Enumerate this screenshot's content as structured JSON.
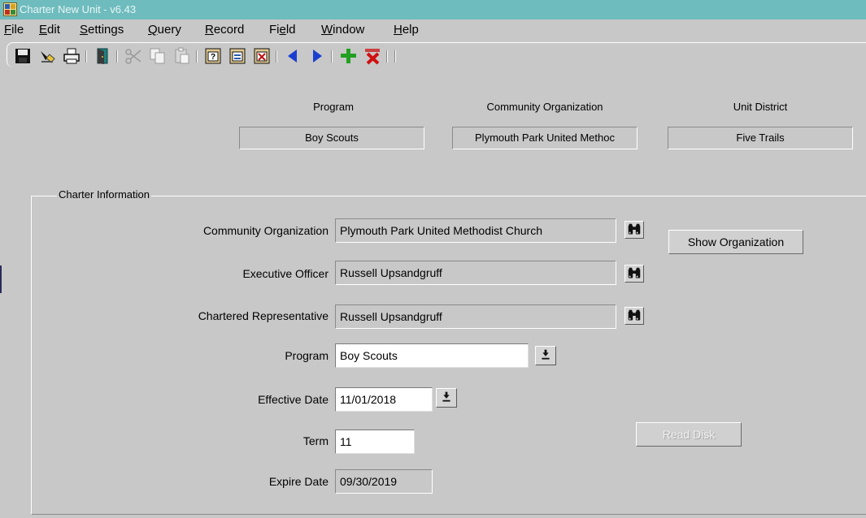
{
  "window": {
    "title": "Charter New Unit - v6.43"
  },
  "menu": {
    "file": {
      "u": "F",
      "rest": "ile"
    },
    "edit": {
      "u": "E",
      "rest": "dit"
    },
    "settings": {
      "u": "S",
      "rest": "ettings"
    },
    "query": {
      "u": "Q",
      "rest": "uery"
    },
    "record": {
      "u": "R",
      "rest": "ecord"
    },
    "field": {
      "pre": "Fi",
      "u": "e",
      "rest": "ld"
    },
    "window": {
      "u": "W",
      "rest": "indow"
    },
    "help": {
      "u": "H",
      "rest": "elp"
    }
  },
  "toolbar_icons": [
    "save-icon",
    "clear-icon",
    "print-icon",
    "exit-icon",
    "cut-icon",
    "copy-icon",
    "paste-icon",
    "query-icon",
    "execute-query-icon",
    "cancel-query-icon",
    "previous-record-icon",
    "next-record-icon",
    "insert-record-icon",
    "delete-record-icon"
  ],
  "header": {
    "program_label": "Program",
    "program_value": "Boy Scouts",
    "community_label": "Community Organization",
    "community_value": "Plymouth Park United Methoc",
    "district_label": "Unit District",
    "district_value": "Five Trails"
  },
  "charter": {
    "group_title": "Charter Information",
    "community_org_label": "Community Organization",
    "community_org_value": "Plymouth Park United Methodist Church",
    "executive_officer_label": "Executive Officer",
    "executive_officer_value": "Russell Upsandgruff",
    "chartered_rep_label": "Chartered Representative",
    "chartered_rep_value": "Russell Upsandgruff",
    "program_label": "Program",
    "program_value": "Boy Scouts",
    "effective_date_label": "Effective Date",
    "effective_date_value": "11/01/2018",
    "term_label": "Term",
    "term_value": "11",
    "expire_date_label": "Expire Date",
    "expire_date_value": "09/30/2019",
    "show_org_button": "Show Organization",
    "read_disk_button": "Read Disk"
  },
  "colors": {
    "titlebar": "#6fbcbe",
    "background": "#c8c8c8"
  }
}
